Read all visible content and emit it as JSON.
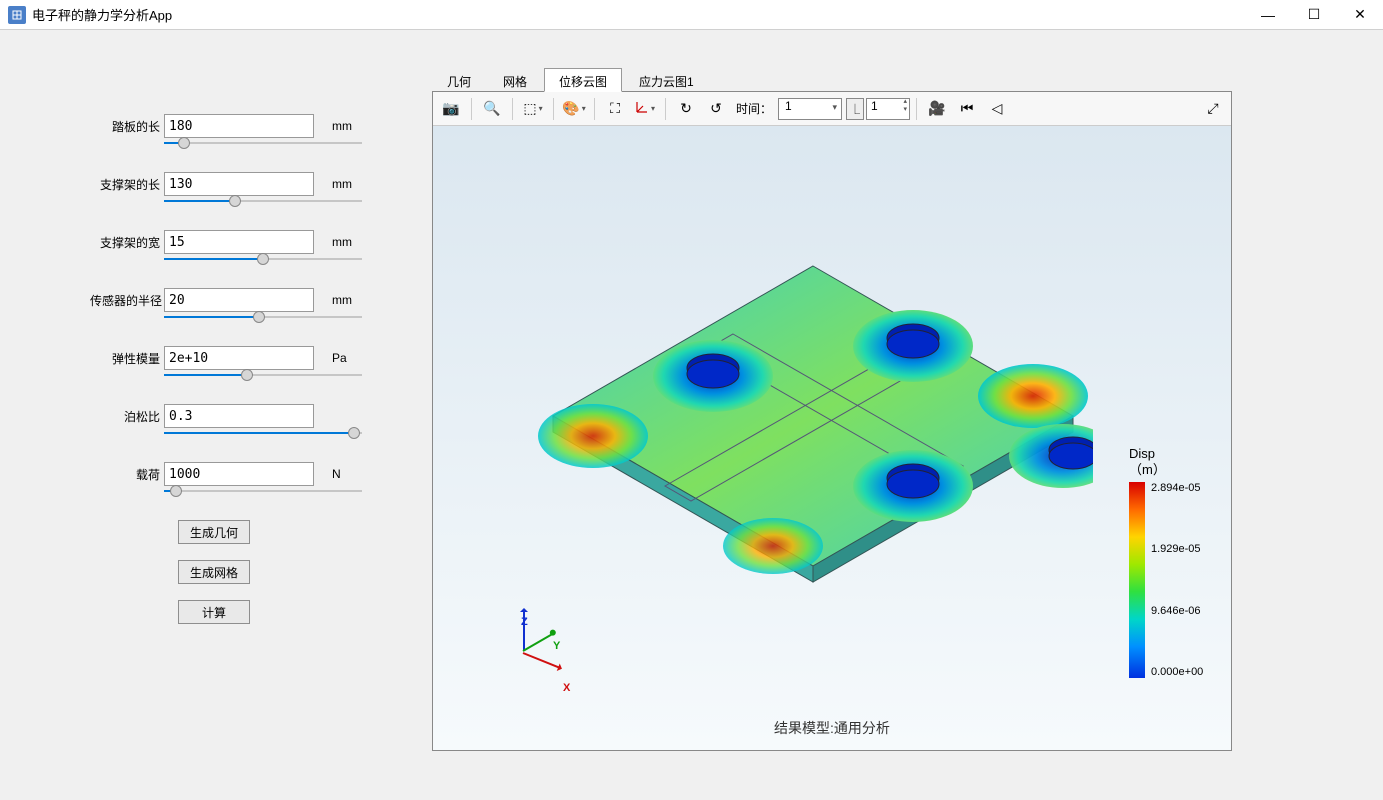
{
  "window": {
    "title": "电子秤的静力学分析App"
  },
  "params": [
    {
      "label": "踏板的长",
      "value": "180",
      "unit": "mm",
      "slider": 10
    },
    {
      "label": "支撑架的长",
      "value": "130",
      "unit": "mm",
      "slider": 36
    },
    {
      "label": "支撑架的宽",
      "value": "15",
      "unit": "mm",
      "slider": 50
    },
    {
      "label": "传感器的半径",
      "value": "20",
      "unit": "mm",
      "slider": 48
    },
    {
      "label": "弹性模量",
      "value": "2e+10",
      "unit": "Pa",
      "slider": 42
    },
    {
      "label": "泊松比",
      "value": "0.3",
      "unit": "",
      "slider": 96
    },
    {
      "label": "载荷",
      "value": "1000",
      "unit": "N",
      "slider": 6
    }
  ],
  "buttons": {
    "geom": "生成几何",
    "mesh": "生成网格",
    "calc": "计算"
  },
  "tabs": [
    {
      "id": "geom",
      "label": "几何",
      "active": false
    },
    {
      "id": "mesh",
      "label": "网格",
      "active": false
    },
    {
      "id": "disp",
      "label": "位移云图",
      "active": true
    },
    {
      "id": "stress1",
      "label": "应力云图1",
      "active": false
    }
  ],
  "toolbar": {
    "time_label": "时间：",
    "time_combo": "1",
    "spin_value": "1"
  },
  "viewer": {
    "caption": "结果模型:通用分析",
    "triad": {
      "x": "X",
      "y": "Y",
      "z": "Z"
    },
    "colorbar": {
      "title1": "Disp",
      "title2": "（m）",
      "ticks": [
        "2.894e-05",
        "1.929e-05",
        "9.646e-06",
        "0.000e+00"
      ]
    }
  }
}
